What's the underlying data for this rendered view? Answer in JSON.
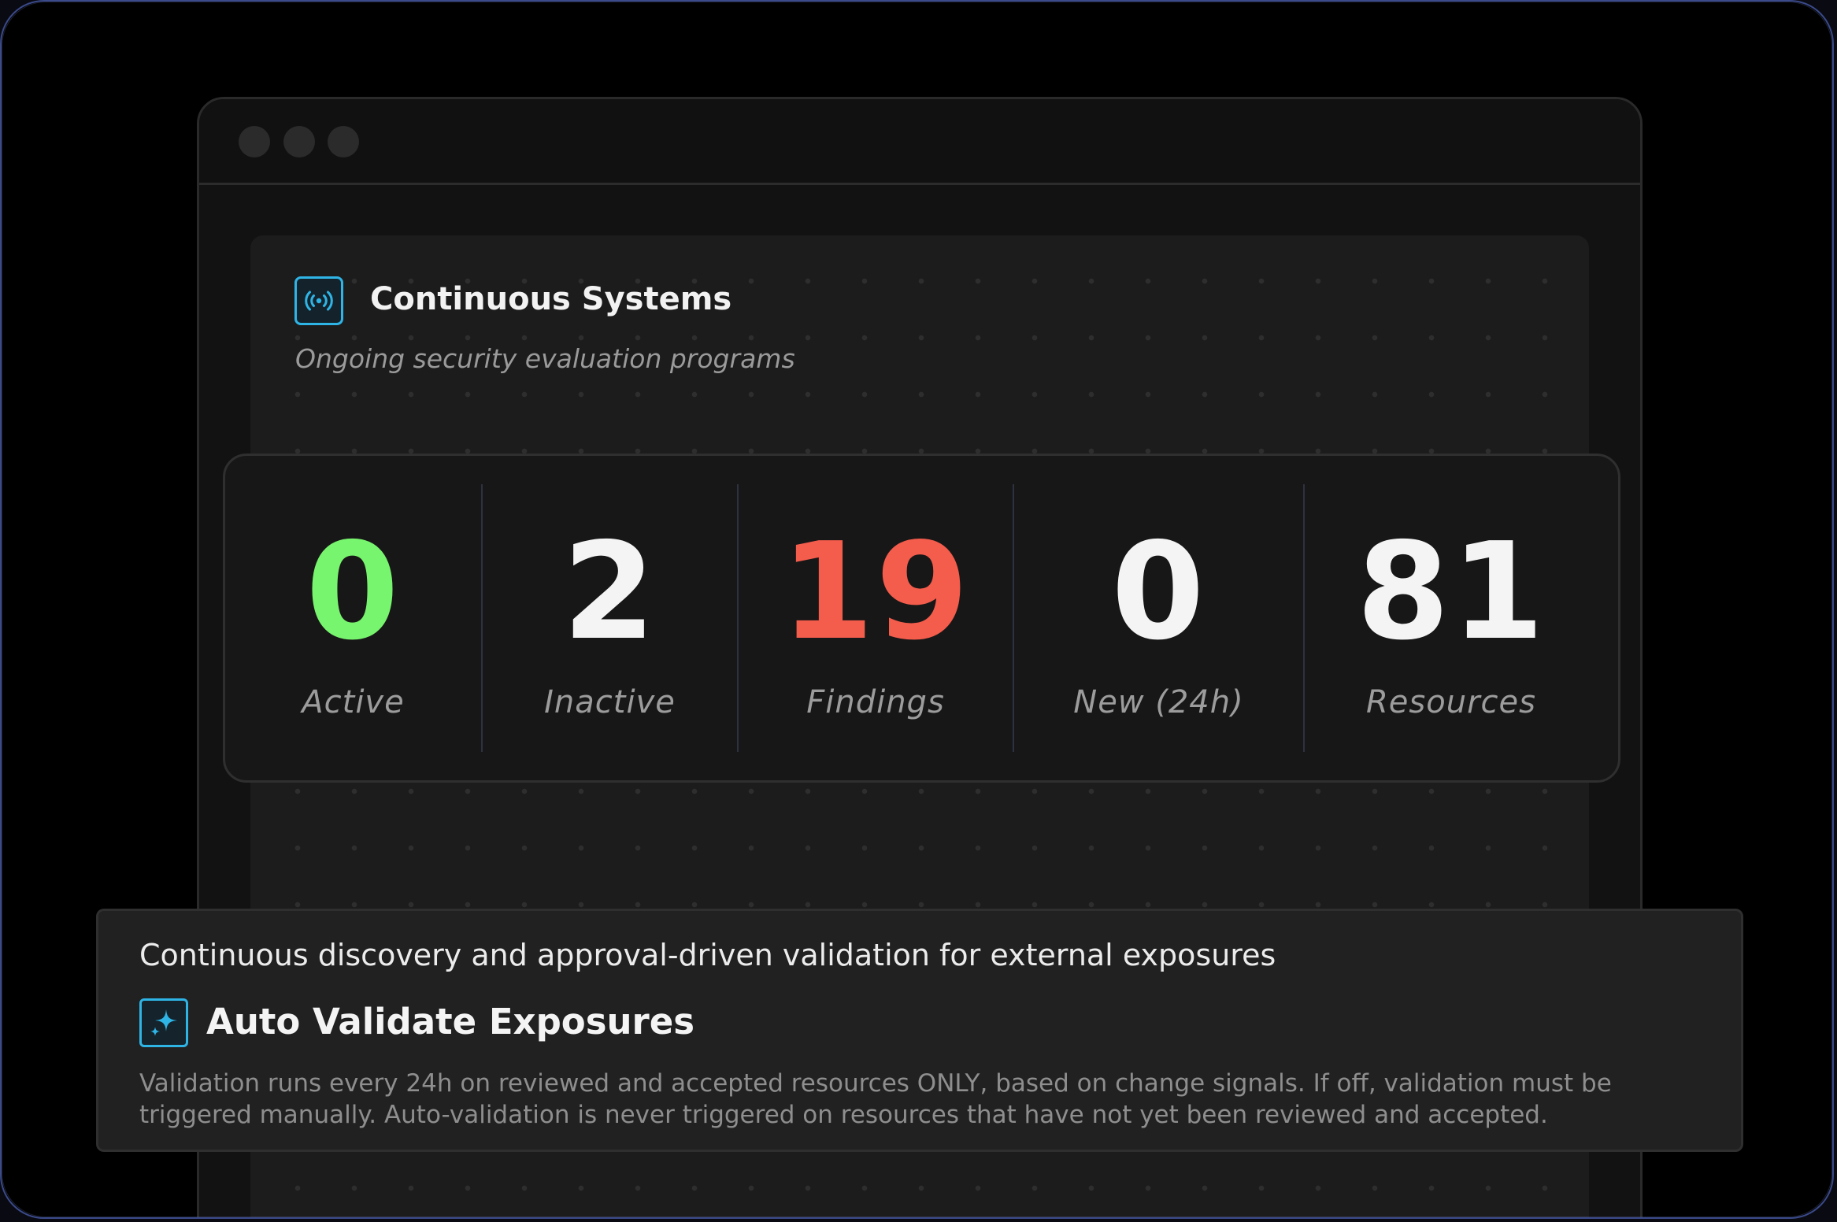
{
  "header": {
    "icon": "broadcast-icon",
    "title": "Continuous Systems",
    "subtitle": "Ongoing security evaluation programs"
  },
  "stats": [
    {
      "value": "0",
      "label": "Active",
      "color": "#78f56e"
    },
    {
      "value": "2",
      "label": "Inactive",
      "color": "#f4f4f4"
    },
    {
      "value": "19",
      "label": "Findings",
      "color": "#f45c4c"
    },
    {
      "value": "0",
      "label": "New (24h)",
      "color": "#f4f4f4"
    },
    {
      "value": "81",
      "label": "Resources",
      "color": "#f4f4f4"
    }
  ],
  "auto_validate": {
    "description": "Continuous discovery and approval-driven validation for external exposures",
    "icon": "sparkle-icon",
    "title": "Auto Validate Exposures",
    "body": "Validation runs every 24h on reviewed and accepted resources ONLY, based on change signals. If off, validation must be triggered manually. Auto-validation is never triggered on resources that have not yet been reviewed and accepted."
  },
  "colors": {
    "accent": "#2fb4e6",
    "active": "#78f56e",
    "findings": "#f45c4c"
  }
}
